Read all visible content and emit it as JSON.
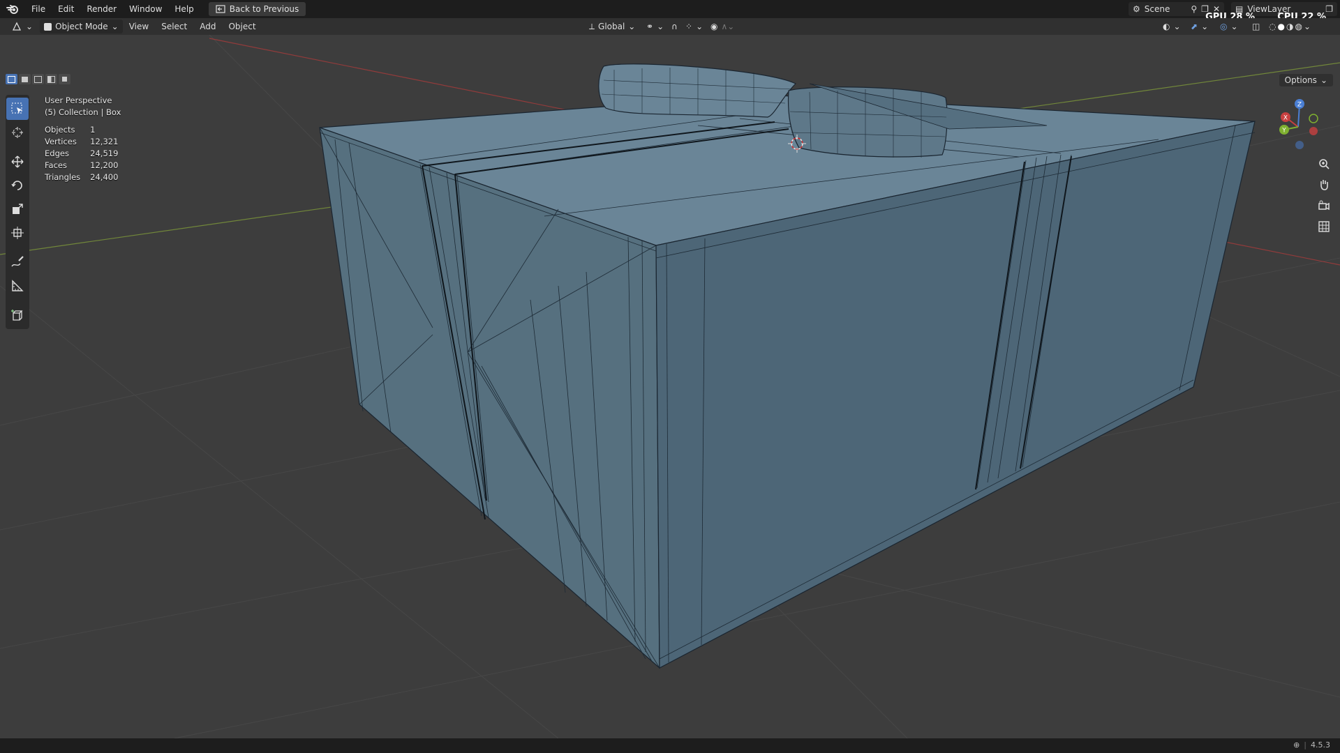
{
  "topbar": {
    "menu": [
      "File",
      "Edit",
      "Render",
      "Window",
      "Help"
    ],
    "back_button": "Back to Previous",
    "scene_label": "Scene",
    "viewlayer_label": "ViewLayer",
    "gpu": "GPU 28 %",
    "cpu": "CPU 22 %"
  },
  "header": {
    "mode": "Object Mode",
    "menu": [
      "View",
      "Select",
      "Add",
      "Object"
    ],
    "orientation": "Global"
  },
  "overlay": {
    "view_name": "User Perspective",
    "collection": "(5) Collection | Box",
    "stats": [
      {
        "label": "Objects",
        "value": "1"
      },
      {
        "label": "Vertices",
        "value": "12,321"
      },
      {
        "label": "Edges",
        "value": "24,519"
      },
      {
        "label": "Faces",
        "value": "12,200"
      },
      {
        "label": "Triangles",
        "value": "24,400"
      }
    ]
  },
  "options_label": "Options",
  "statusbar": {
    "version": "4.5.3"
  },
  "gizmo": {
    "x": "X",
    "y": "Y",
    "z": "Z"
  },
  "colors": {
    "active_tool": "#4772b3",
    "mesh_face": "#5b7586",
    "grid_x": "#a83b3b",
    "grid_y": "#7f9a3a"
  },
  "icons": {
    "tools": [
      "select-box-icon",
      "cursor-icon",
      "move-icon",
      "rotate-icon",
      "scale-icon",
      "transform-icon",
      "annotate-icon",
      "measure-icon",
      "add-cube-icon"
    ],
    "nav": [
      "zoom-icon",
      "pan-icon",
      "camera-icon",
      "ortho-grid-icon"
    ]
  }
}
